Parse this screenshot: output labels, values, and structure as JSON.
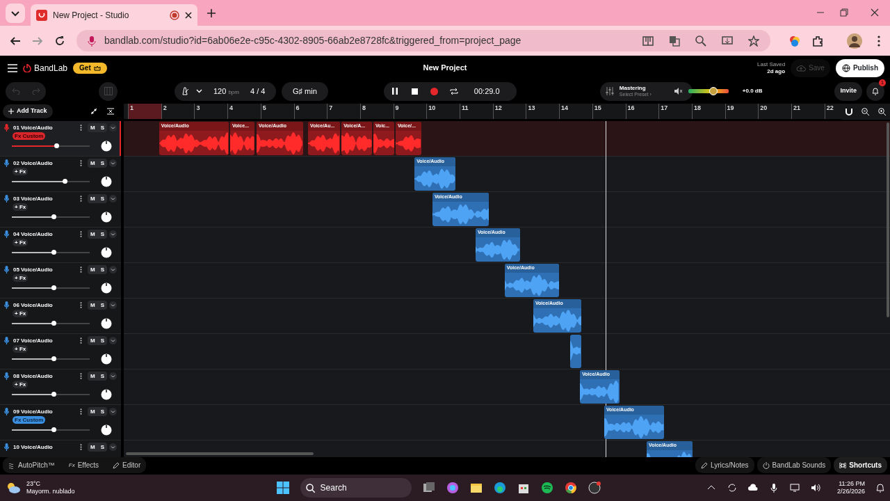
{
  "browser": {
    "tab_title": "New Project - Studio",
    "recording": true,
    "url": "bandlab.com/studio?id=6ab06e2e-c95c-4302-8905-66ab2e8728fc&triggered_from=project_page"
  },
  "header": {
    "brand": "BandLab",
    "get_button": "Get",
    "project_title": "New Project",
    "last_saved_label": "Last Saved",
    "last_saved_time": "2d ago",
    "save_button": {
      "label": "Save",
      "disabled": true
    },
    "publish_button": "Publish"
  },
  "transport": {
    "tempo": "120",
    "tempo_unit": "bpm",
    "time_signature": "4 / 4",
    "key": "G♯ min",
    "playing": true,
    "time": "00:29.0",
    "mastering_title": "Mastering",
    "mastering_preset": "Select Preset ›",
    "master_level": {
      "level": 0.62
    },
    "master_gain": "+0.0 dB",
    "invite_button": "Invite",
    "notification_count": "1"
  },
  "add_track_button": "Add Track",
  "ruler": [
    "1",
    "2",
    "3",
    "4",
    "5",
    "6",
    "7",
    "8",
    "9",
    "10",
    "11",
    "12",
    "13",
    "14",
    "15",
    "16",
    "17",
    "18",
    "19",
    "20",
    "21",
    "22"
  ],
  "tracks": [
    {
      "name": "01 Voice/Audio",
      "selected": true,
      "color": "#e5262b",
      "mute": "M",
      "solo": "S",
      "fx": {
        "kind": "custom",
        "label": "Fx Custom"
      },
      "volume": {
        "level": 0.57
      },
      "clips": [
        {
          "label": "Voice/Audio"
        },
        {
          "label": "Voice..."
        },
        {
          "label": "Voice/Audio"
        },
        {
          "label": "Voice/Au..."
        },
        {
          "label": "Voice/A..."
        },
        {
          "label": "Voic..."
        },
        {
          "label": "Voice/..."
        }
      ]
    },
    {
      "name": "02 Voice/Audio",
      "selected": false,
      "color": "#3b8fe0",
      "mute": "M",
      "solo": "S",
      "fx": {
        "kind": "add",
        "label": "+ Fx"
      },
      "volume": {
        "level": 0.68
      },
      "clips": [
        {
          "label": "Voice/Audio"
        }
      ]
    },
    {
      "name": "03 Voice/Audio",
      "selected": false,
      "color": "#3b8fe0",
      "mute": "M",
      "solo": "S",
      "fx": {
        "kind": "add",
        "label": "+ Fx"
      },
      "volume": {
        "level": 0.54
      },
      "clips": [
        {
          "label": "Voice/Audio"
        }
      ]
    },
    {
      "name": "04 Voice/Audio",
      "selected": false,
      "color": "#3b8fe0",
      "mute": "M",
      "solo": "S",
      "fx": {
        "kind": "add",
        "label": "+ Fx"
      },
      "volume": {
        "level": 0.54
      },
      "clips": [
        {
          "label": "Voice/Audio"
        }
      ]
    },
    {
      "name": "05 Voice/Audio",
      "selected": false,
      "color": "#3b8fe0",
      "mute": "M",
      "solo": "S",
      "fx": {
        "kind": "add",
        "label": "+ Fx"
      },
      "volume": {
        "level": 0.54
      },
      "clips": [
        {
          "label": "Voice/Audio"
        }
      ]
    },
    {
      "name": "06 Voice/Audio",
      "selected": false,
      "color": "#3b8fe0",
      "mute": "M",
      "solo": "S",
      "fx": {
        "kind": "add",
        "label": "+ Fx"
      },
      "volume": {
        "level": 0.54
      },
      "clips": [
        {
          "label": "Voice/Audio"
        }
      ]
    },
    {
      "name": "07 Voice/Audio",
      "selected": false,
      "color": "#3b8fe0",
      "mute": "M",
      "solo": "S",
      "fx": {
        "kind": "add",
        "label": "+ Fx"
      },
      "volume": {
        "level": 0.54
      },
      "clips": [
        {
          "kind": "unlabeled"
        }
      ]
    },
    {
      "name": "08 Voice/Audio",
      "selected": false,
      "color": "#3b8fe0",
      "mute": "M",
      "solo": "S",
      "fx": {
        "kind": "add",
        "label": "+ Fx"
      },
      "volume": {
        "level": 0.54
      },
      "clips": [
        {
          "label": "Voice/Audio"
        }
      ]
    },
    {
      "name": "09 Voice/Audio",
      "selected": false,
      "color": "#3b8fe0",
      "mute": "M",
      "solo": "S",
      "fx": {
        "kind": "custom",
        "label": "Fx Custom"
      },
      "volume": {
        "level": 0.54
      },
      "clips": [
        {
          "label": "Voice/Audio"
        }
      ]
    },
    {
      "name": "10 Voice/Audio",
      "selected": false,
      "color": "#3b8fe0",
      "mute": "M",
      "solo": "S",
      "clips": [
        {
          "label": "Voice/Audio"
        }
      ]
    }
  ],
  "bottom_bar": {
    "left": [
      {
        "kind": "autopitch",
        "label": "AutoPitch™"
      },
      {
        "kind": "effects",
        "icon_text": "Fx",
        "label": "Effects"
      },
      {
        "kind": "editor",
        "label": "Editor"
      }
    ],
    "right": [
      {
        "kind": "lyrics",
        "label": "Lyrics/Notes"
      },
      {
        "kind": "sounds",
        "label": "BandLab Sounds"
      },
      {
        "kind": "shortcuts",
        "label": "Shortcuts"
      }
    ]
  },
  "taskbar": {
    "temperature": "23°C",
    "weather": "Mayorm. nublado",
    "search": "Search",
    "time": "11:26 PM",
    "date": "2/26/2026"
  }
}
